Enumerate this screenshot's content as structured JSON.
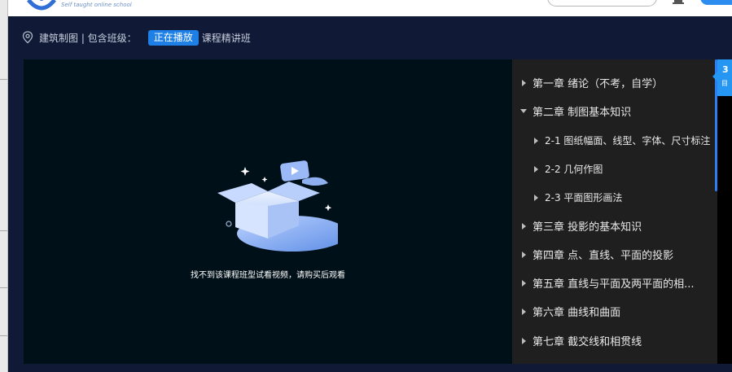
{
  "header": {
    "logo_subtitle": "Self taught online school"
  },
  "breadcrumb": {
    "course": "建筑制图 | 包含班级：",
    "playing_badge": "正在播放",
    "class_name": "课程精讲班"
  },
  "player": {
    "notice": "找不到该课程班型试看视频，请购买后观看"
  },
  "chapters": [
    {
      "label": "第一章 绪论（不考，自学）",
      "level": 0,
      "expanded": false
    },
    {
      "label": "第二章 制图基本知识",
      "level": 0,
      "expanded": true
    },
    {
      "label": "2-1 图纸幅面、线型、字体、尺寸标注",
      "level": 1
    },
    {
      "label": "2-2 几何作图",
      "level": 1
    },
    {
      "label": "2-3 平面图形画法",
      "level": 1
    },
    {
      "label": "第三章 投影的基本知识",
      "level": 0,
      "expanded": false
    },
    {
      "label": "第四章 点、直线、平面的投影",
      "level": 0,
      "expanded": false
    },
    {
      "label": "第五章 直线与平面及两平面的相...",
      "level": 0,
      "expanded": false
    },
    {
      "label": "第六章 曲线和曲面",
      "level": 0,
      "expanded": false
    },
    {
      "label": "第七章 截交线和相贯线",
      "level": 0,
      "expanded": false
    }
  ],
  "side_tab": {
    "line1": "3",
    "line2": "目"
  },
  "colors": {
    "page_bg": "#101a36",
    "accent": "#1e80e6",
    "player_bg": "#001018",
    "list_bg": "#1f1f20"
  }
}
